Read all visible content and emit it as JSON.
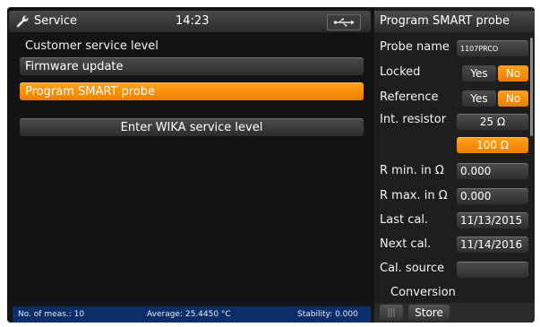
{
  "topbar": {
    "title": "Service",
    "time": "14:23"
  },
  "left": {
    "section_label": "Customer service level",
    "buttons": [
      "Firmware update",
      "Program SMART probe"
    ],
    "wika_button": "Enter WIKA service level"
  },
  "status": {
    "meas": "No. of meas.: 10",
    "average": "Average: 25.4450 °C",
    "stability": "Stability: 0.000"
  },
  "right": {
    "title": "Program SMART probe",
    "rows": {
      "probe_name": {
        "label": "Probe name",
        "value": "1107PRCO"
      },
      "locked": {
        "label": "Locked",
        "yes": "Yes",
        "no": "No"
      },
      "reference": {
        "label": "Reference",
        "yes": "Yes",
        "no": "No"
      },
      "int_resistor": {
        "label": "Int. resistor",
        "opt1": "25 Ω",
        "opt2": "100 Ω"
      },
      "rmin": {
        "label": "R min. in Ω",
        "value": "0.000"
      },
      "rmax": {
        "label": "R max. in Ω",
        "value": "0.000"
      },
      "last_cal": {
        "label": "Last cal.",
        "value": "11/13/2015"
      },
      "next_cal": {
        "label": "Next cal.",
        "value": "11/14/2016"
      },
      "cal_source": {
        "label": "Cal. source",
        "value": ""
      },
      "conversion": {
        "label": "Conversion"
      }
    },
    "store": "Store"
  },
  "colors": {
    "accent": "#f7880a",
    "statusbar": "#0b2e69"
  }
}
